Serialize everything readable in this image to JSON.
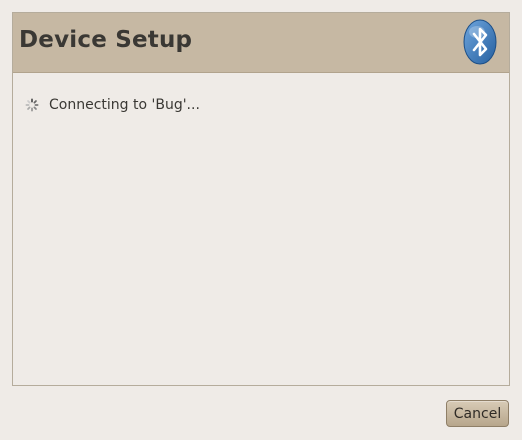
{
  "dialog": {
    "title": "Device Setup",
    "status_text": "Connecting to 'Bug'...",
    "icons": {
      "bluetooth": "bluetooth-icon",
      "spinner": "spinner-icon"
    }
  },
  "actions": {
    "cancel_label": "Cancel"
  },
  "colors": {
    "header_bg": "#c6b8a3",
    "window_bg": "#efebe7",
    "bluetooth_blue": "#3f7fc0"
  }
}
